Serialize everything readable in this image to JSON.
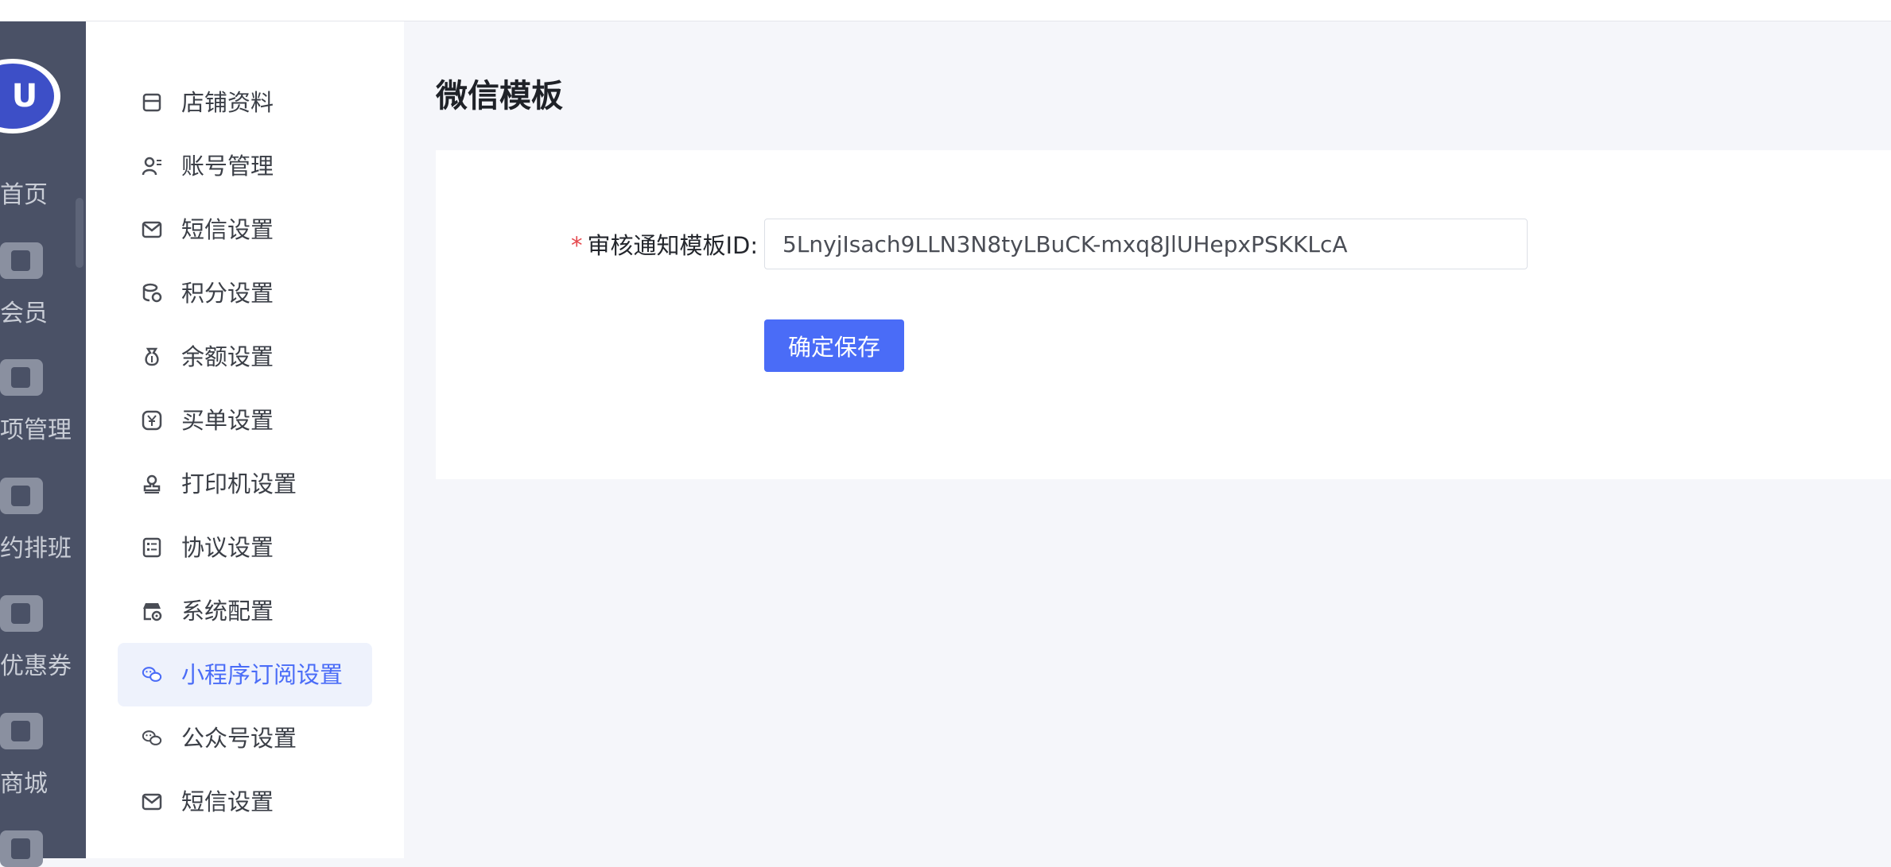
{
  "rail": {
    "logo_text": "U",
    "items": [
      {
        "label": "首页",
        "icon": "home-icon"
      },
      {
        "label": "会员",
        "icon": "member-icon"
      },
      {
        "label": "项管理",
        "icon": "folder-list-icon"
      },
      {
        "label": "约排班",
        "icon": "calendar-check-icon"
      },
      {
        "label": "优惠券",
        "icon": "wallet-icon"
      },
      {
        "label": "商城",
        "icon": "shopping-bag-icon"
      }
    ]
  },
  "submenu": {
    "items": [
      {
        "label": "店铺资料",
        "icon": "store-icon"
      },
      {
        "label": "账号管理",
        "icon": "user-account-icon"
      },
      {
        "label": "短信设置",
        "icon": "mail-icon"
      },
      {
        "label": "积分设置",
        "icon": "coins-icon"
      },
      {
        "label": "余额设置",
        "icon": "money-bag-icon"
      },
      {
        "label": "买单设置",
        "icon": "yen-icon"
      },
      {
        "label": "打印机设置",
        "icon": "stamp-icon"
      },
      {
        "label": "协议设置",
        "icon": "checklist-icon"
      },
      {
        "label": "系统配置",
        "icon": "shop-settings-icon"
      },
      {
        "label": "小程序订阅设置",
        "icon": "wechat-icon",
        "active": true
      },
      {
        "label": "公众号设置",
        "icon": "wechat-icon"
      },
      {
        "label": "短信设置",
        "icon": "mail-icon"
      }
    ]
  },
  "main": {
    "title": "微信模板",
    "form": {
      "required_mark": "*",
      "label": "审核通知模板ID:",
      "value": "5LnyjIsach9LLN3N8tyLBuCK-mxq8JlUHepxPSKKLcA"
    },
    "save_label": "确定保存"
  },
  "colors": {
    "accent": "#4a6cf7",
    "rail_bg": "#4a5166",
    "required": "#e5484d"
  }
}
